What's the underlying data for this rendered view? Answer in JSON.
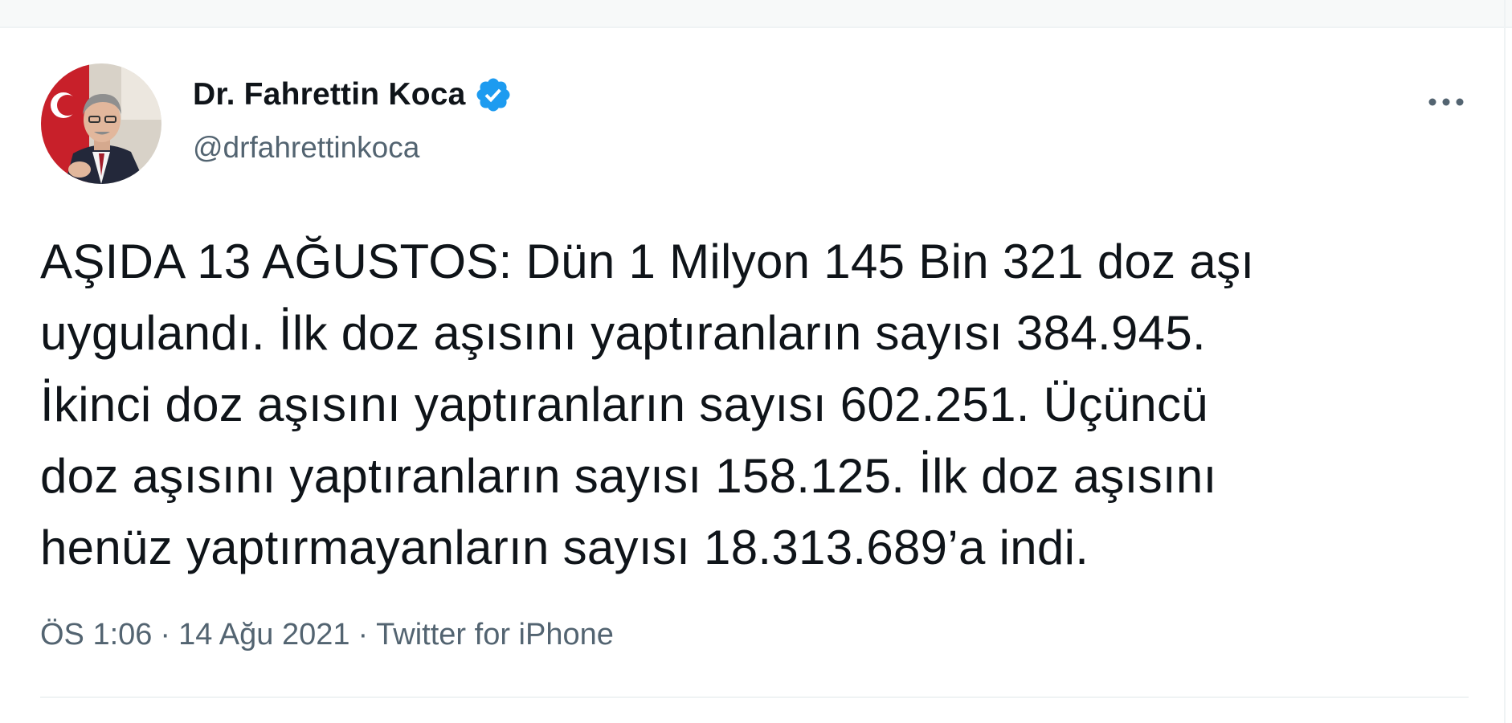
{
  "tweet": {
    "author": {
      "display_name": "Dr. Fahrettin Koca",
      "handle": "@drfahrettinkoca",
      "verified": true
    },
    "text": "AŞIDA 13 AĞUSTOS: Dün 1 Milyon 145 Bin 321 doz aşı\nuygulandı. İlk doz aşısını yaptıranların sayısı 384.945.\nİkinci doz aşısını yaptıranların sayısı 602.251. Üçüncü\ndoz aşısını yaptıranların sayısı 158.125. İlk doz aşısını\nhenüz yaptırmayanların sayısı 18.313.689’a indi.",
    "meta": {
      "time": "ÖS 1:06",
      "date": "14 Ağu 2021",
      "source": "Twitter for iPhone",
      "separator": "·"
    }
  },
  "icons": {
    "verified": "verified-badge-icon",
    "more": "more-dots-icon",
    "avatar": "profile-avatar"
  },
  "colors": {
    "text_primary": "#0f1419",
    "text_secondary": "#536471",
    "verified_blue": "#1d9bf0",
    "divider": "#eff3f4"
  }
}
